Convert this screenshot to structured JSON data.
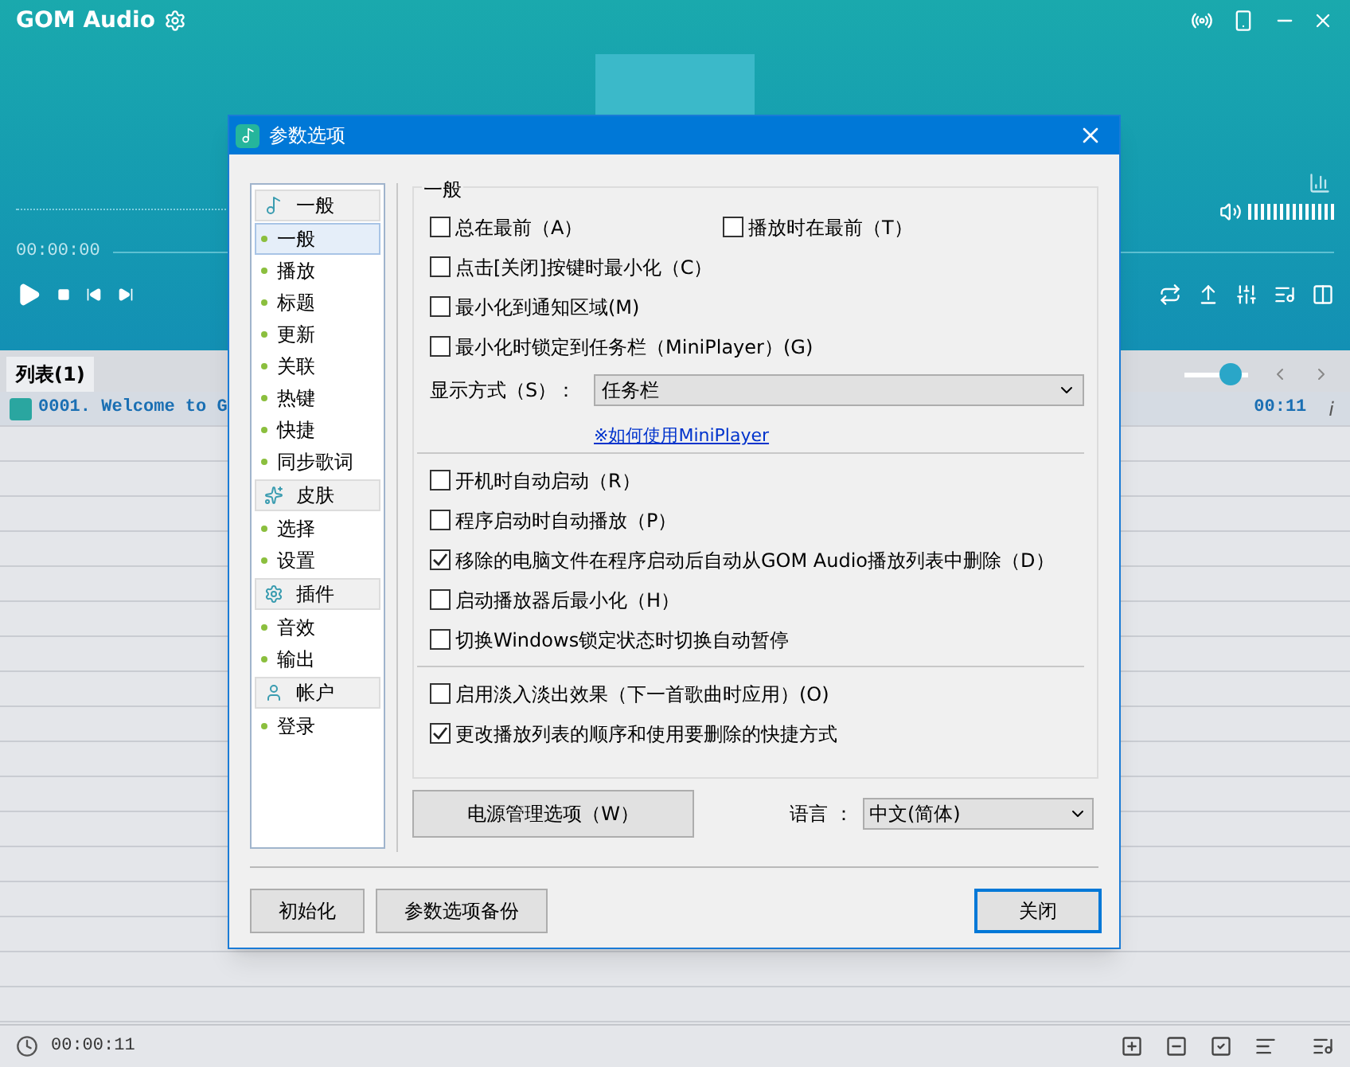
{
  "player": {
    "app_title": "GOM Audio",
    "time": "00:00:00",
    "playlist_tab": "列表(1)",
    "tracks": [
      {
        "title": "0001. Welcome to G",
        "duration": "00:11",
        "info": "i",
        "selected": true
      }
    ],
    "total_time": "00:00:11",
    "zoom_slider": {
      "level": 0.85
    }
  },
  "dialog": {
    "title": "参数选项",
    "sidebar": [
      {
        "label": "一般",
        "items": [
          {
            "label": "一般",
            "selected": true
          },
          {
            "label": "播放",
            "selected": false
          },
          {
            "label": "标题",
            "selected": false
          },
          {
            "label": "更新",
            "selected": false
          },
          {
            "label": "关联",
            "selected": false
          },
          {
            "label": "热键",
            "selected": false
          },
          {
            "label": "快捷",
            "selected": false
          },
          {
            "label": "同步歌词",
            "selected": false
          }
        ]
      },
      {
        "label": "皮肤",
        "items": [
          {
            "label": "选择",
            "selected": false
          },
          {
            "label": "设置",
            "selected": false
          }
        ]
      },
      {
        "label": "插件",
        "items": [
          {
            "label": "音效",
            "selected": false
          },
          {
            "label": "输出",
            "selected": false
          }
        ]
      },
      {
        "label": "帐户",
        "items": [
          {
            "label": "登录",
            "selected": false
          }
        ]
      }
    ],
    "group_title": "一般",
    "options": [
      {
        "kind": "checkboxes",
        "checkboxes": [
          {
            "label": "总在最前（A）",
            "checked": false
          },
          {
            "label": "播放时在最前（T）",
            "checked": false
          }
        ]
      },
      {
        "kind": "checkboxes",
        "checkboxes": [
          {
            "label": "点击[关闭]按键时最小化（C）",
            "checked": false
          }
        ]
      },
      {
        "kind": "checkboxes",
        "checkboxes": [
          {
            "label": "最小化到通知区域(M)",
            "checked": false
          }
        ]
      },
      {
        "kind": "checkboxes",
        "checkboxes": [
          {
            "label": "最小化时锁定到任务栏（MiniPlayer）(G)",
            "checked": false
          }
        ]
      },
      {
        "kind": "select",
        "label": "显示方式（S）：",
        "value": "任务栏"
      },
      {
        "kind": "link",
        "label": "※如何使用MiniPlayer"
      },
      {
        "kind": "divider"
      },
      {
        "kind": "checkboxes",
        "checkboxes": [
          {
            "label": "开机时自动启动（R）",
            "checked": false
          }
        ]
      },
      {
        "kind": "checkboxes",
        "checkboxes": [
          {
            "label": "程序启动时自动播放（P）",
            "checked": false
          }
        ]
      },
      {
        "kind": "checkboxes",
        "checkboxes": [
          {
            "label": "移除的电脑文件在程序启动后自动从GOM Audio播放列表中删除（D）",
            "checked": true
          }
        ]
      },
      {
        "kind": "checkboxes",
        "checkboxes": [
          {
            "label": "启动播放器后最小化（H）",
            "checked": false
          }
        ]
      },
      {
        "kind": "checkboxes",
        "checkboxes": [
          {
            "label": "切换Windows锁定状态时切换自动暂停",
            "checked": false
          }
        ]
      },
      {
        "kind": "divider"
      },
      {
        "kind": "checkboxes",
        "checkboxes": [
          {
            "label": "启用淡入淡出效果（下一首歌曲时应用）(O)",
            "checked": false
          }
        ]
      },
      {
        "kind": "checkboxes",
        "checkboxes": [
          {
            "label": "更改播放列表的顺序和使用要删除的快捷方式",
            "checked": true
          }
        ]
      }
    ],
    "power_button": "电源管理选项（W）",
    "language_label": "语言 ：",
    "language_value": "中文(简体)",
    "buttons": [
      {
        "label": "初始化",
        "kind": "normal"
      },
      {
        "label": "参数选项备份",
        "kind": "normal"
      },
      {
        "label": "关闭",
        "kind": "default"
      }
    ]
  }
}
